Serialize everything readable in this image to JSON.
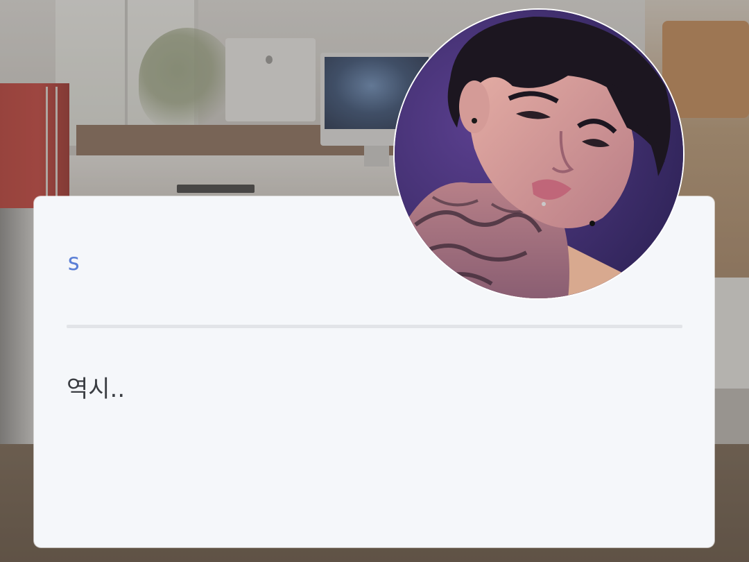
{
  "message_card": {
    "sender_name": "s",
    "message": "역시..",
    "colors": {
      "card_background": "#f5f7fa",
      "sender_name": "#5b7fd6",
      "message_text": "#3a3d42",
      "divider": "#e2e4e8"
    }
  },
  "avatar": {
    "icon": "profile-photo",
    "background_color": "#3d2d6a"
  }
}
